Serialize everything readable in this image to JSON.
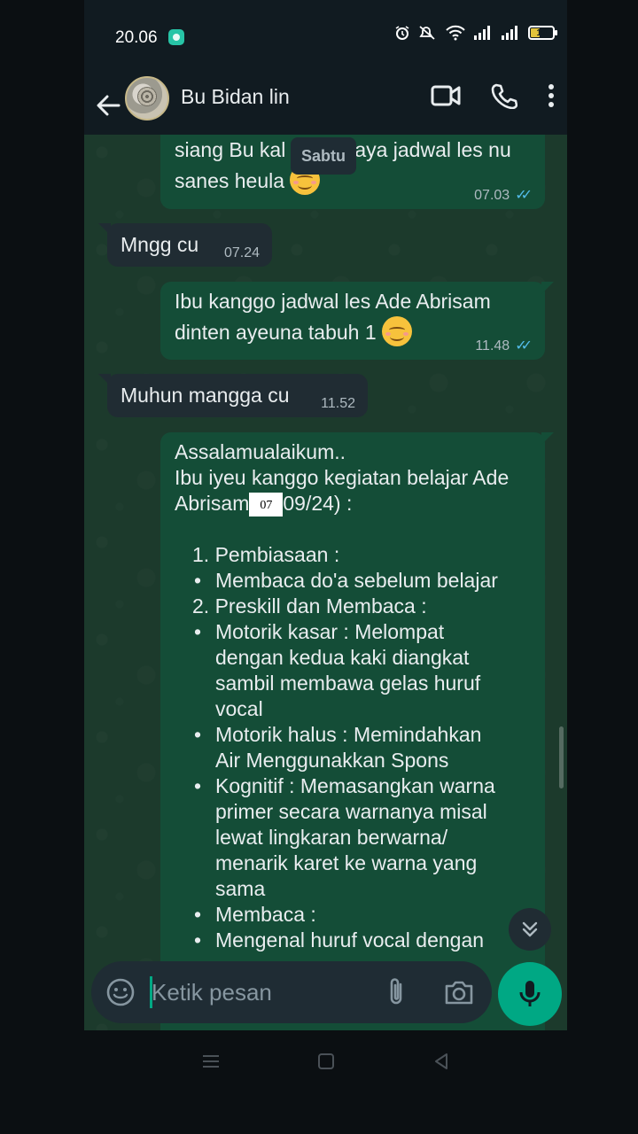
{
  "status_bar": {
    "time": "20.06",
    "battery_level": "19"
  },
  "header": {
    "contact_name": "Bu Bidan lin"
  },
  "chat": {
    "date_chip": "Sabtu",
    "messages": [
      {
        "direction": "outgoing",
        "lines": [
          "siang Bu kal",
          "aya jadwal les nu",
          "sanes heula"
        ],
        "time": "07.03",
        "status": "read"
      },
      {
        "direction": "incoming",
        "text": "Mngg cu",
        "time": "07.24"
      },
      {
        "direction": "outgoing",
        "lines": [
          "Ibu kanggo jadwal les Ade Abrisam",
          "dinten ayeuna tabuh 1"
        ],
        "time": "11.48",
        "status": "read"
      },
      {
        "direction": "incoming",
        "text": "Muhun mangga cu",
        "time": "11.52"
      },
      {
        "direction": "outgoing",
        "greeting": "Assalamualaikum..",
        "intro_1": "Ibu iyeu kanggo kegiatan belajar Ade",
        "intro_2_a": "Abrisam",
        "intro_2_box": "07",
        "intro_2_b": "09/24) :",
        "items": [
          "1. Pembiasaan :",
          "Membaca do'a sebelum belajar",
          "2. Preskill dan Membaca :",
          "Motorik kasar : Melompat",
          "dengan kedua kaki diangkat",
          "sambil membawa gelas huruf",
          "vocal",
          "Motorik halus : Memindahkan",
          "Air Menggunakkan Spons",
          "Kognitif : Memasangkan warna",
          "primer secara warnanya misal",
          "lewat lingkaran berwarna/",
          "menarik karet ke warna yang",
          "sama",
          "Membaca :",
          "Mengenal huruf vocal dengan"
        ]
      }
    ]
  },
  "input": {
    "placeholder": "Ketik pesan"
  },
  "colors": {
    "accent": "#00a884",
    "outgoing_bubble": "#144d37",
    "incoming_bubble": "#202c33",
    "read_ticks": "#53bdeb"
  },
  "icons": [
    "back-arrow-icon",
    "video-call-icon",
    "phone-call-icon",
    "more-options-icon",
    "emoji-icon",
    "attach-icon",
    "camera-icon",
    "mic-icon",
    "scroll-down-icon",
    "battery-icon",
    "wifi-icon",
    "signal-icon",
    "alarm-icon",
    "mute-icon"
  ]
}
